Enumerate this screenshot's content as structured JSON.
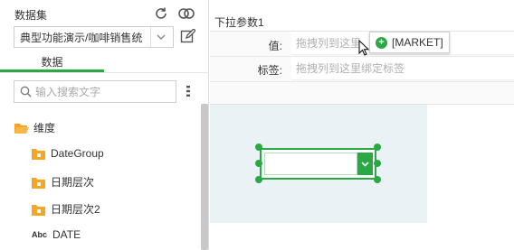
{
  "left_panel": {
    "dataset_title": "数据集",
    "dataset_selected": "典型功能演示/咖啡销售统",
    "tab_data": "数据",
    "search_placeholder": "输入搜索文字",
    "tree": [
      {
        "label": "维度",
        "icon": "folder-open-icon"
      },
      {
        "label": "DateGroup",
        "icon": "folder-icon"
      },
      {
        "label": "日期层次",
        "icon": "folder-icon"
      },
      {
        "label": "日期层次2",
        "icon": "folder-icon"
      },
      {
        "label": "DATE",
        "icon": "abc-icon",
        "icon_text": "Abc"
      }
    ]
  },
  "properties": {
    "title": "下拉参数1",
    "value_label": "值:",
    "value_placeholder": "拖拽列到这里",
    "tag_label": "标签:",
    "tag_placeholder": "拖拽列到这里绑定标签"
  },
  "drag_chip": {
    "label": "[MARKET]"
  },
  "colors": {
    "accent": "#2aa844",
    "canvas_bg": "#eaf2f6"
  }
}
